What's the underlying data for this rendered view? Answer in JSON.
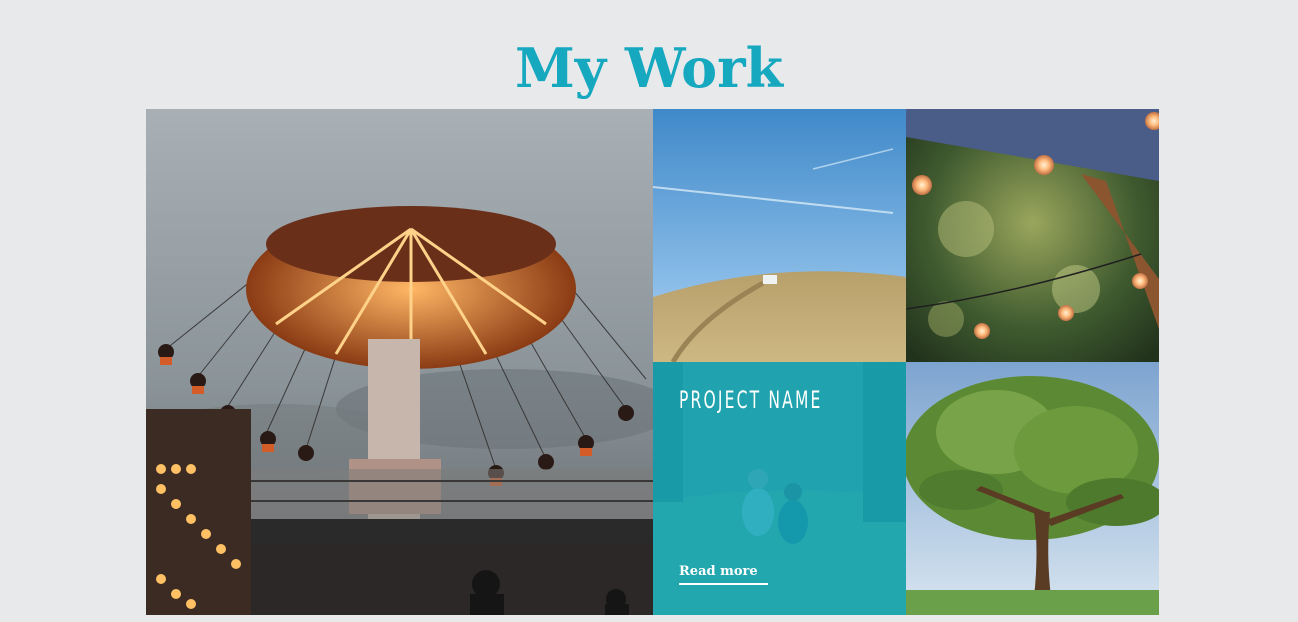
{
  "page": {
    "title": "My Work"
  },
  "theme": {
    "accent": "#15a8bf",
    "background": "#e8e9eb"
  },
  "portfolio": {
    "tiles": [
      {
        "image": "carnival-swing-ride-photo"
      },
      {
        "image": "hillside-car-photo"
      },
      {
        "image": "string-lights-photo"
      },
      {
        "image": "children-playing-photo",
        "project_name": "PROJECT NAME",
        "read_more": "Read more"
      },
      {
        "image": "oak-tree-photo"
      }
    ]
  }
}
